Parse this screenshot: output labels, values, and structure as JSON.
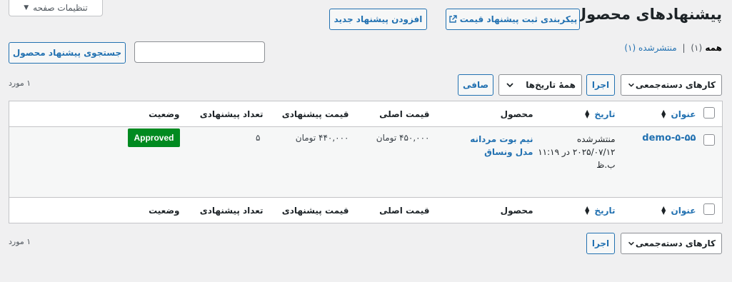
{
  "screen_options": {
    "label": "تنظیمات صفحه"
  },
  "header": {
    "title": "پیشنهادهای محصول",
    "config_button": "پیکربندی ثبت پیشنهاد قیمت",
    "add_button": "افزودن پیشنهاد جدید"
  },
  "filters_nav": {
    "all": "همه",
    "all_count": "(۱)",
    "separator": "|",
    "published": "منتشرشده",
    "published_count": "(۱)"
  },
  "search": {
    "placeholder": "",
    "button": "جستجوی پیشنهاد محصول"
  },
  "bulk": {
    "label": "کارهای دسته‌جمعی",
    "apply": "اجرا"
  },
  "date_filter": {
    "label": "همهٔ تاریخ‌ها"
  },
  "filter_button": "صافی",
  "item_count": "۱ مورد",
  "columns": {
    "title": "عنوان",
    "date": "تاریخ",
    "product": "محصول",
    "original_price": "قیمت اصلی",
    "offer_price": "قیمت پیشنهادی",
    "offer_count": "تعداد پیشنهادی",
    "status": "وضعیت"
  },
  "rows": [
    {
      "title": "demo-۵-۵۵",
      "date_status": "منتشرشده",
      "date_value": "۲۰۲۵/۰۷/۱۲ در ۱۱:۱۹ ب.ظ",
      "product_line1": "نیم بوت مردانه",
      "product_line2": "مدل ونساق",
      "original_price": "۴۵۰,۰۰۰ تومان",
      "offer_price": "۴۴۰,۰۰۰ تومان",
      "offer_count": "۵",
      "status": "Approved"
    }
  ],
  "colors": {
    "accent": "#2271b1",
    "approved": "#008a20",
    "background": "#f0f0f1"
  },
  "icons": {
    "external": "external-link-icon",
    "chevron": "chevron-down-icon",
    "sort": "sort-icon"
  }
}
